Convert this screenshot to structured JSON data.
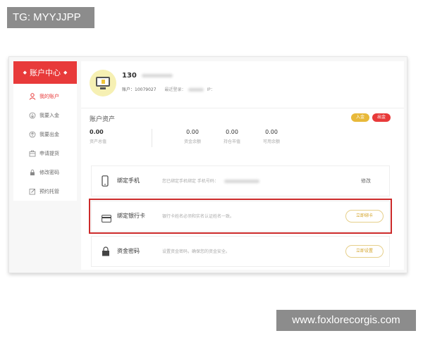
{
  "watermarks": {
    "top_left": "TG: MYYJJPP",
    "bottom_right": "www.foxlorecorgis.com"
  },
  "sidebar": {
    "title": "账户中心",
    "items": [
      {
        "label": "我的账户",
        "icon": "user-icon",
        "active": true
      },
      {
        "label": "我要入金",
        "icon": "deposit-icon",
        "active": false
      },
      {
        "label": "我要出金",
        "icon": "withdraw-icon",
        "active": false
      },
      {
        "label": "申请提货",
        "icon": "pickup-icon",
        "active": false
      },
      {
        "label": "修改密码",
        "icon": "lock-icon",
        "active": false
      },
      {
        "label": "预约托管",
        "icon": "edit-icon",
        "active": false
      }
    ]
  },
  "profile": {
    "name": "130",
    "account_label": "账户：10079027",
    "last_login_label": "最近登录：",
    "ip_label": "IP："
  },
  "assets": {
    "title": "账户资产",
    "deposit_button": "入金",
    "withdraw_button": "出金",
    "stats": [
      {
        "value": "0.00",
        "label": "资产总值"
      },
      {
        "value": "0.00",
        "label": "资金余额"
      },
      {
        "value": "0.00",
        "label": "持仓市值"
      },
      {
        "value": "0.00",
        "label": "可用余额"
      }
    ]
  },
  "rows": [
    {
      "name": "绑定手机",
      "desc": "您已绑定手机绑定 手机号码：",
      "action": "修改",
      "icon": "phone-icon"
    },
    {
      "name": "绑定银行卡",
      "desc": "银行卡姓名必须和实名认证姓名一致。",
      "action": "立即绑卡",
      "icon": "bank-card-icon"
    },
    {
      "name": "资金密码",
      "desc": "设置资金密码，确保您的资金安全。",
      "action": "立即设置",
      "icon": "lock-icon"
    }
  ],
  "colors": {
    "brand_red": "#e83a3a",
    "gold": "#e8b93a",
    "highlight": "#cc2a2a"
  }
}
